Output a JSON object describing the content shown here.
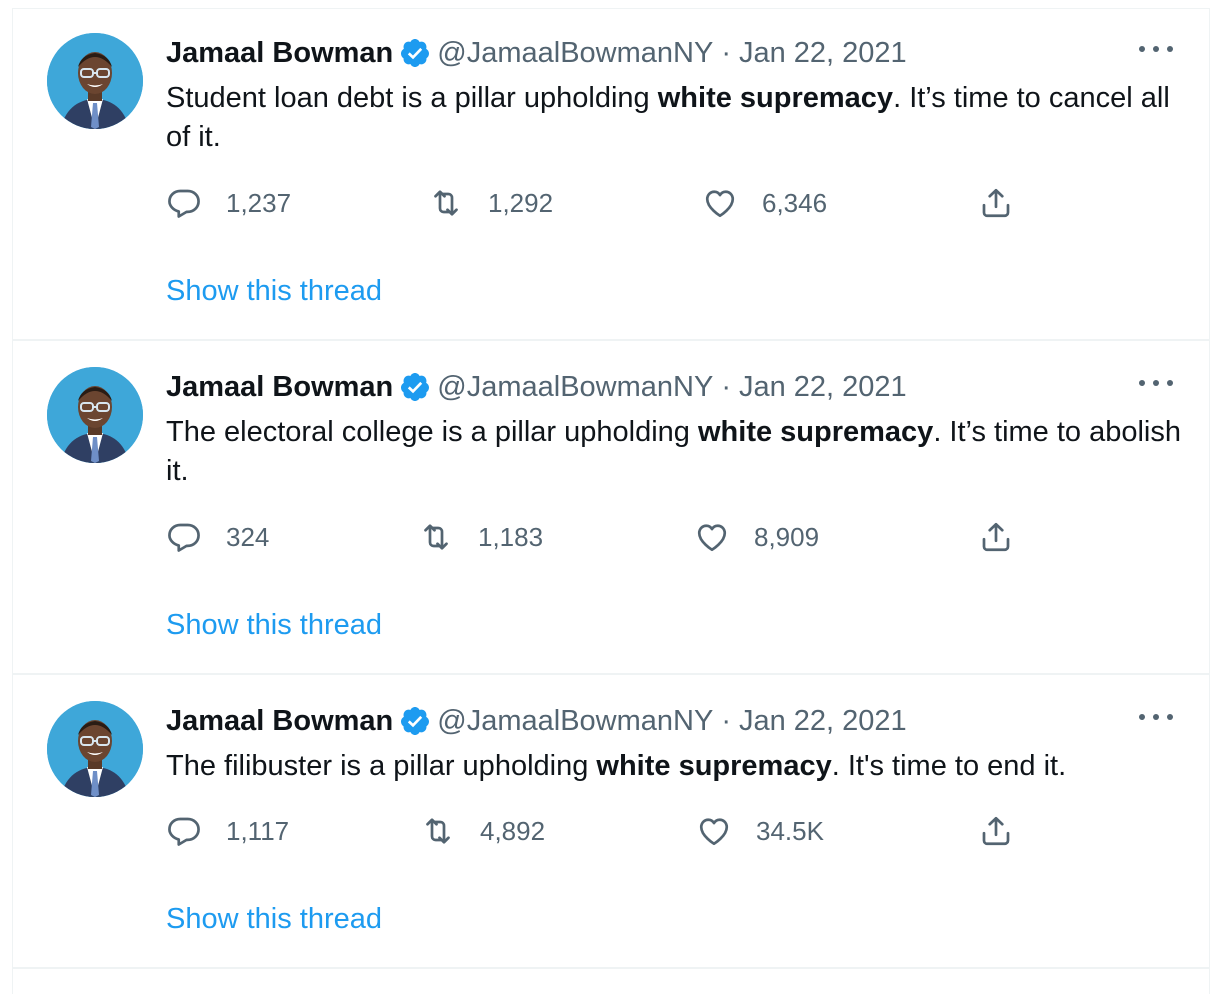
{
  "tweets": [
    {
      "author_name": "Jamaal Bowman",
      "handle": "@JamaalBowmanNY",
      "separator": "·",
      "date": "Jan 22, 2021",
      "text_before": "Student loan debt is a pillar upholding ",
      "text_bold": "white supremacy",
      "text_after": ". It’s time to cancel all of it.",
      "replies": "1,237",
      "retweets": "1,292",
      "likes": "6,346",
      "show_thread": "Show this thread"
    },
    {
      "author_name": "Jamaal Bowman",
      "handle": "@JamaalBowmanNY",
      "separator": "·",
      "date": "Jan 22, 2021",
      "text_before": "The electoral college is a pillar upholding ",
      "text_bold": "white supremacy",
      "text_after": ". It’s time to abolish it.",
      "replies": "324",
      "retweets": "1,183",
      "likes": "8,909",
      "show_thread": "Show this thread"
    },
    {
      "author_name": "Jamaal Bowman",
      "handle": "@JamaalBowmanNY",
      "separator": "·",
      "date": "Jan 22, 2021",
      "text_before": "The filibuster is a pillar upholding ",
      "text_bold": "white supremacy",
      "text_after": ". It's time to end it.",
      "replies": "1,117",
      "retweets": "4,892",
      "likes": "34.5K",
      "show_thread": "Show this thread"
    }
  ],
  "colors": {
    "accent": "#1d9bf0",
    "secondary_text": "#536471",
    "avatar_background": "#3ea7d9",
    "verified_badge": "#1d9bf0"
  },
  "icons": {
    "reply": "reply-icon",
    "retweet": "retweet-icon",
    "like": "like-icon",
    "share": "share-icon",
    "verified": "verified-badge-icon",
    "more": "more-options-icon"
  }
}
